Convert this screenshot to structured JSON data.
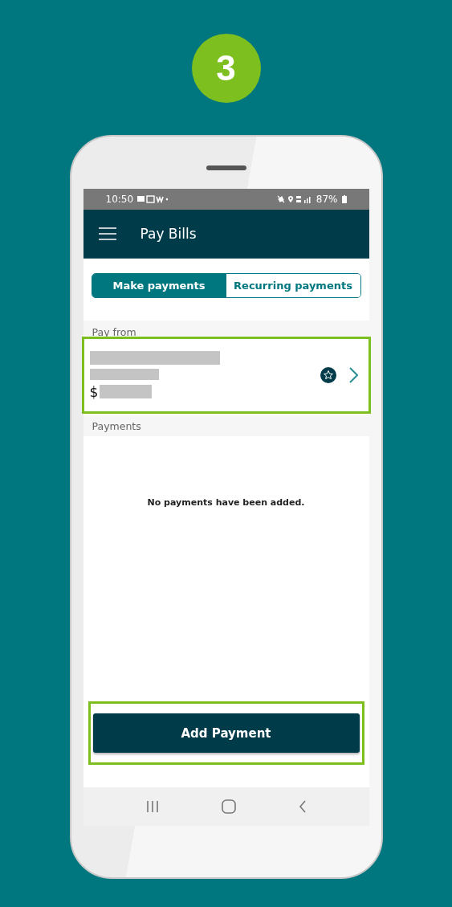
{
  "step_badge": "3",
  "status_bar": {
    "time": "10:50",
    "battery": "87%"
  },
  "app_bar": {
    "title": "Pay Bills"
  },
  "tabs": [
    {
      "label": "Make payments",
      "selected": true
    },
    {
      "label": "Recurring payments",
      "selected": false
    }
  ],
  "pay_from": {
    "label": "Pay from",
    "account": {
      "currency": "$",
      "highlighted": true
    }
  },
  "payments": {
    "label": "Payments",
    "empty_message": "No payments have been added."
  },
  "add_button": {
    "label": "Add Payment",
    "highlighted": true
  }
}
